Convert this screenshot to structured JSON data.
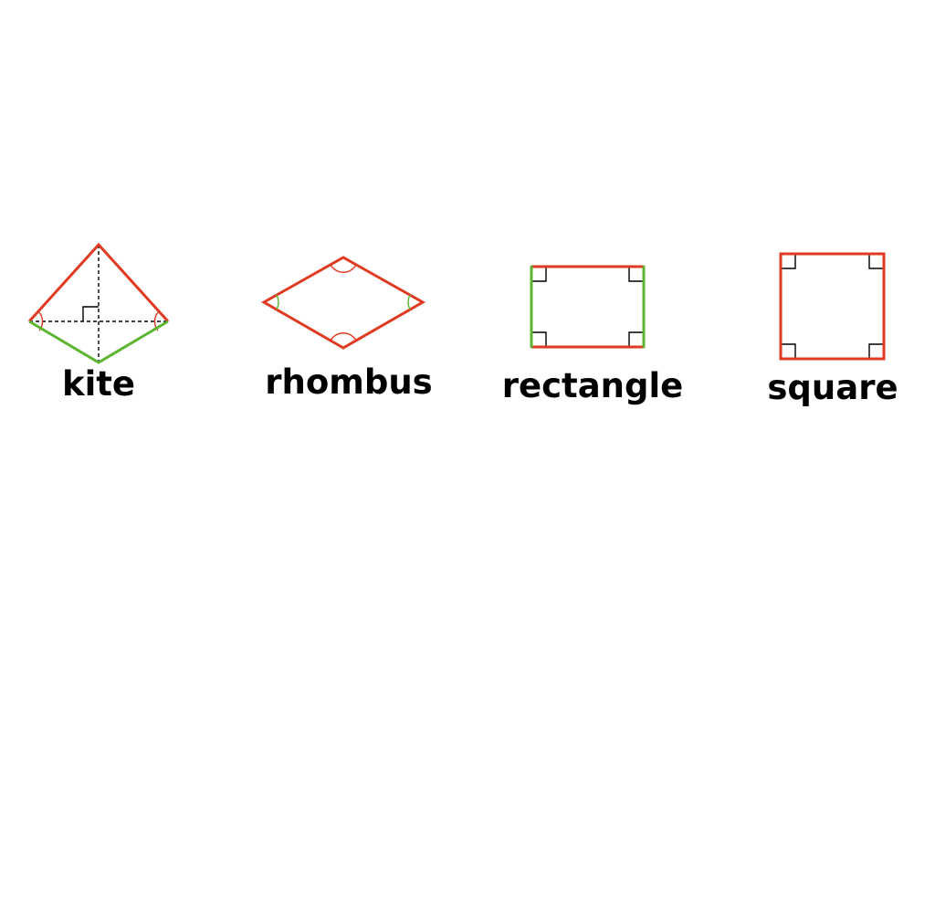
{
  "colors": {
    "red": "#e03a22",
    "green": "#5cb531",
    "black": "#000000"
  },
  "shapes": [
    {
      "id": "kite",
      "label": "kite"
    },
    {
      "id": "rhombus",
      "label": "rhombus"
    },
    {
      "id": "rectangle",
      "label": "rectangle"
    },
    {
      "id": "square",
      "label": "square"
    }
  ]
}
